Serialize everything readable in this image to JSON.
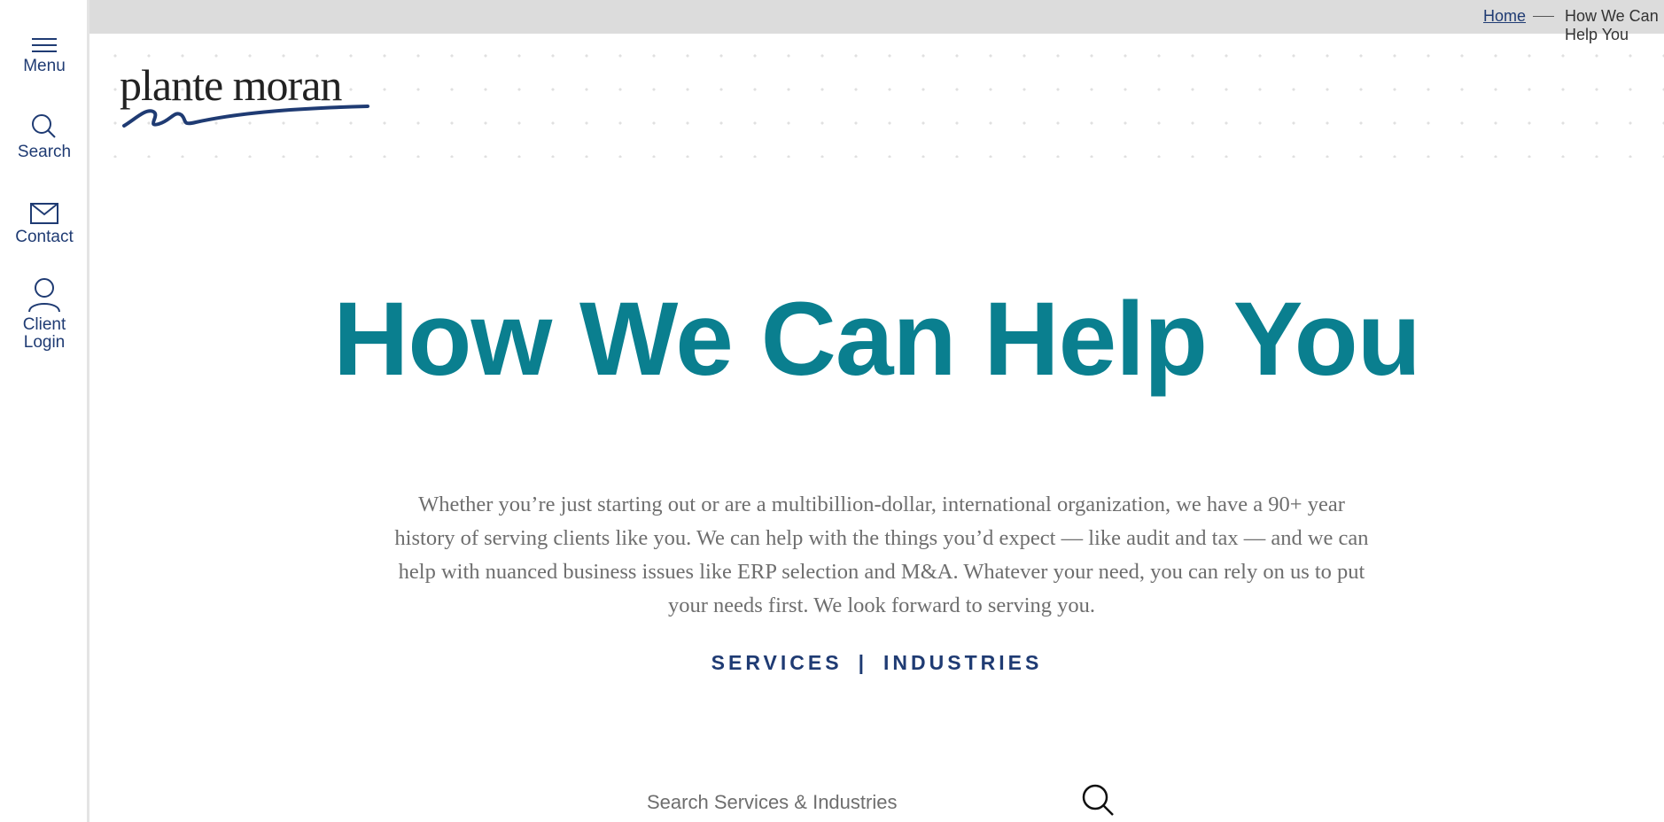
{
  "sidebar": {
    "items": [
      {
        "label": "Menu",
        "icon": "hamburger-menu-icon"
      },
      {
        "label": "Search",
        "icon": "search-icon"
      },
      {
        "label": "Contact",
        "icon": "envelope-icon"
      },
      {
        "label": "Client Login",
        "icon": "user-icon"
      }
    ]
  },
  "breadcrumb": {
    "home": "Home",
    "current": "How We Can Help You"
  },
  "logo": {
    "text": "plante moran"
  },
  "hero": {
    "title": "How We Can Help You",
    "intro": "Whether you’re just starting out or are a multibillion-dollar, international organization, we have a 90+ year history of serving clients like you. We can help with the things you’d expect — like audit and tax — and we can help with nuanced business issues like ERP selection and M&A. Whatever your need, you can rely on us to put your needs first. We look forward to serving you."
  },
  "categories": {
    "services": "SERVICES",
    "separator": "|",
    "industries": "INDUSTRIES"
  },
  "search": {
    "placeholder": "Search Services & Industries"
  },
  "colors": {
    "brand_navy": "#1f3b73",
    "title_teal": "#0a7f8f",
    "body_gray": "#6e6e6e",
    "breadcrumb_bar": "#dcdcdc"
  }
}
